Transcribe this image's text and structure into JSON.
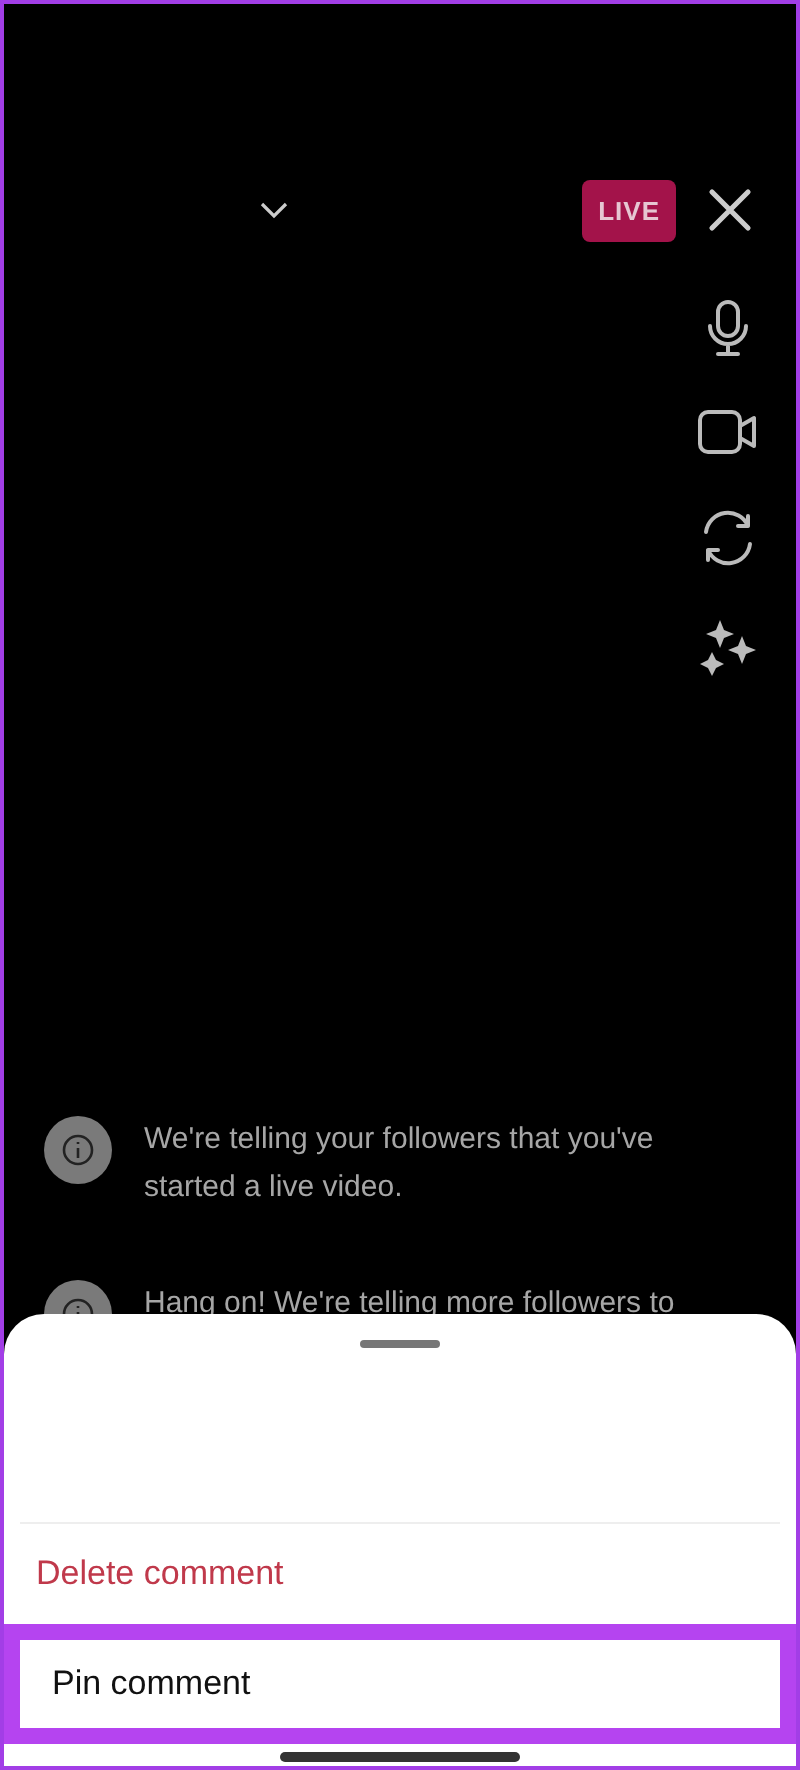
{
  "top_bar": {
    "live_badge": "LIVE"
  },
  "side_controls": [
    {
      "kind": "mic"
    },
    {
      "kind": "camera"
    },
    {
      "kind": "flip"
    },
    {
      "kind": "effects"
    }
  ],
  "messages": [
    {
      "text": "We're telling your followers that you've started a live video."
    },
    {
      "text": "Hang on! We're telling more followers to"
    }
  ],
  "sheet": {
    "actions": [
      {
        "label": "Delete comment",
        "kind": "destructive",
        "highlighted": false
      },
      {
        "label": "Pin comment",
        "kind": "normal",
        "highlighted": true
      }
    ]
  }
}
